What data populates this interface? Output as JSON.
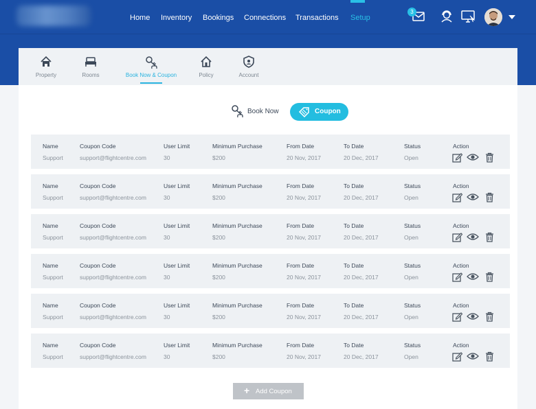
{
  "nav": {
    "items": [
      "Home",
      "Inventory",
      "Bookings",
      "Connections",
      "Transactions",
      "Setup"
    ],
    "active": "Setup",
    "icons": [
      "mail-icon",
      "support-agent-icon",
      "desktop-share-icon"
    ],
    "mail_badge": "3",
    "accent_color": "#29c0e6",
    "bar_color": "#1a4ea6"
  },
  "tabs": [
    {
      "label": "Property",
      "icon": "property-icon"
    },
    {
      "label": "Rooms",
      "icon": "bed-icon"
    },
    {
      "label": "Book Now & Coupon",
      "icon": "key-hand-icon"
    },
    {
      "label": "Policy",
      "icon": "house-icon"
    },
    {
      "label": "Account",
      "icon": "shield-icon"
    }
  ],
  "active_tab": "Book Now & Coupon",
  "toggle": {
    "book_now": "Book Now",
    "coupon": "Coupon",
    "selected": "Coupon"
  },
  "columns": [
    "Name",
    "Coupon Code",
    "User Limit",
    "Minimum Purchase",
    "From Date",
    "To Date",
    "Status",
    "Action"
  ],
  "coupons": [
    {
      "name": "Support",
      "code": "support@flightcentre.com",
      "user_limit": "30",
      "min_purchase": "$200",
      "from": "20 Nov, 2017",
      "to": "20 Dec, 2017",
      "status": "Open"
    },
    {
      "name": "Support",
      "code": "support@flightcentre.com",
      "user_limit": "30",
      "min_purchase": "$200",
      "from": "20 Nov, 2017",
      "to": "20 Dec, 2017",
      "status": "Open"
    },
    {
      "name": "Support",
      "code": "support@flightcentre.com",
      "user_limit": "30",
      "min_purchase": "$200",
      "from": "20 Nov, 2017",
      "to": "20 Dec, 2017",
      "status": "Open"
    },
    {
      "name": "Support",
      "code": "support@flightcentre.com",
      "user_limit": "30",
      "min_purchase": "$200",
      "from": "20 Nov, 2017",
      "to": "20 Dec, 2017",
      "status": "Open"
    },
    {
      "name": "Support",
      "code": "support@flightcentre.com",
      "user_limit": "30",
      "min_purchase": "$200",
      "from": "20 Nov, 2017",
      "to": "20 Dec, 2017",
      "status": "Open"
    },
    {
      "name": "Support",
      "code": "support@flightcentre.com",
      "user_limit": "30",
      "min_purchase": "$200",
      "from": "20 Nov, 2017",
      "to": "20 Dec, 2017",
      "status": "Open"
    }
  ],
  "row_actions": [
    "edit-icon",
    "view-icon",
    "delete-icon"
  ],
  "add_button": "Add Coupon"
}
